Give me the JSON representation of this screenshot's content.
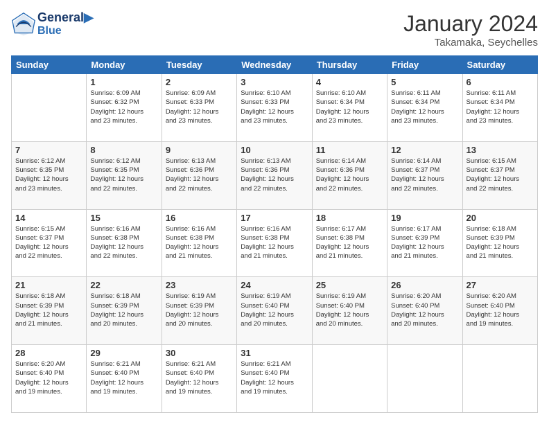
{
  "header": {
    "logo_line1": "General",
    "logo_line2": "Blue",
    "month_title": "January 2024",
    "subtitle": "Takamaka, Seychelles"
  },
  "days_of_week": [
    "Sunday",
    "Monday",
    "Tuesday",
    "Wednesday",
    "Thursday",
    "Friday",
    "Saturday"
  ],
  "weeks": [
    [
      {
        "day": "",
        "info": ""
      },
      {
        "day": "1",
        "info": "Sunrise: 6:09 AM\nSunset: 6:32 PM\nDaylight: 12 hours\nand 23 minutes."
      },
      {
        "day": "2",
        "info": "Sunrise: 6:09 AM\nSunset: 6:33 PM\nDaylight: 12 hours\nand 23 minutes."
      },
      {
        "day": "3",
        "info": "Sunrise: 6:10 AM\nSunset: 6:33 PM\nDaylight: 12 hours\nand 23 minutes."
      },
      {
        "day": "4",
        "info": "Sunrise: 6:10 AM\nSunset: 6:34 PM\nDaylight: 12 hours\nand 23 minutes."
      },
      {
        "day": "5",
        "info": "Sunrise: 6:11 AM\nSunset: 6:34 PM\nDaylight: 12 hours\nand 23 minutes."
      },
      {
        "day": "6",
        "info": "Sunrise: 6:11 AM\nSunset: 6:34 PM\nDaylight: 12 hours\nand 23 minutes."
      }
    ],
    [
      {
        "day": "7",
        "info": ""
      },
      {
        "day": "8",
        "info": "Sunrise: 6:12 AM\nSunset: 6:35 PM\nDaylight: 12 hours\nand 22 minutes."
      },
      {
        "day": "9",
        "info": "Sunrise: 6:13 AM\nSunset: 6:36 PM\nDaylight: 12 hours\nand 22 minutes."
      },
      {
        "day": "10",
        "info": "Sunrise: 6:13 AM\nSunset: 6:36 PM\nDaylight: 12 hours\nand 22 minutes."
      },
      {
        "day": "11",
        "info": "Sunrise: 6:14 AM\nSunset: 6:36 PM\nDaylight: 12 hours\nand 22 minutes."
      },
      {
        "day": "12",
        "info": "Sunrise: 6:14 AM\nSunset: 6:37 PM\nDaylight: 12 hours\nand 22 minutes."
      },
      {
        "day": "13",
        "info": "Sunrise: 6:15 AM\nSunset: 6:37 PM\nDaylight: 12 hours\nand 22 minutes."
      }
    ],
    [
      {
        "day": "14",
        "info": ""
      },
      {
        "day": "15",
        "info": "Sunrise: 6:16 AM\nSunset: 6:38 PM\nDaylight: 12 hours\nand 22 minutes."
      },
      {
        "day": "16",
        "info": "Sunrise: 6:16 AM\nSunset: 6:38 PM\nDaylight: 12 hours\nand 21 minutes."
      },
      {
        "day": "17",
        "info": "Sunrise: 6:16 AM\nSunset: 6:38 PM\nDaylight: 12 hours\nand 21 minutes."
      },
      {
        "day": "18",
        "info": "Sunrise: 6:17 AM\nSunset: 6:38 PM\nDaylight: 12 hours\nand 21 minutes."
      },
      {
        "day": "19",
        "info": "Sunrise: 6:17 AM\nSunset: 6:39 PM\nDaylight: 12 hours\nand 21 minutes."
      },
      {
        "day": "20",
        "info": "Sunrise: 6:18 AM\nSunset: 6:39 PM\nDaylight: 12 hours\nand 21 minutes."
      }
    ],
    [
      {
        "day": "21",
        "info": ""
      },
      {
        "day": "22",
        "info": "Sunrise: 6:18 AM\nSunset: 6:39 PM\nDaylight: 12 hours\nand 20 minutes."
      },
      {
        "day": "23",
        "info": "Sunrise: 6:19 AM\nSunset: 6:39 PM\nDaylight: 12 hours\nand 20 minutes."
      },
      {
        "day": "24",
        "info": "Sunrise: 6:19 AM\nSunset: 6:40 PM\nDaylight: 12 hours\nand 20 minutes."
      },
      {
        "day": "25",
        "info": "Sunrise: 6:19 AM\nSunset: 6:40 PM\nDaylight: 12 hours\nand 20 minutes."
      },
      {
        "day": "26",
        "info": "Sunrise: 6:20 AM\nSunset: 6:40 PM\nDaylight: 12 hours\nand 20 minutes."
      },
      {
        "day": "27",
        "info": "Sunrise: 6:20 AM\nSunset: 6:40 PM\nDaylight: 12 hours\nand 19 minutes."
      }
    ],
    [
      {
        "day": "28",
        "info": "Sunrise: 6:20 AM\nSunset: 6:40 PM\nDaylight: 12 hours\nand 19 minutes."
      },
      {
        "day": "29",
        "info": "Sunrise: 6:21 AM\nSunset: 6:40 PM\nDaylight: 12 hours\nand 19 minutes."
      },
      {
        "day": "30",
        "info": "Sunrise: 6:21 AM\nSunset: 6:40 PM\nDaylight: 12 hours\nand 19 minutes."
      },
      {
        "day": "31",
        "info": "Sunrise: 6:21 AM\nSunset: 6:40 PM\nDaylight: 12 hours\nand 19 minutes."
      },
      {
        "day": "",
        "info": ""
      },
      {
        "day": "",
        "info": ""
      },
      {
        "day": "",
        "info": ""
      }
    ]
  ],
  "week7_sunday": {
    "info": "Sunrise: 6:12 AM\nSunset: 6:35 PM\nDaylight: 12 hours\nand 23 minutes."
  },
  "week14_sunday": {
    "info": "Sunrise: 6:15 AM\nSunset: 6:37 PM\nDaylight: 12 hours\nand 22 minutes."
  },
  "week21_sunday": {
    "info": "Sunrise: 6:18 AM\nSunset: 6:39 PM\nDaylight: 12 hours\nand 21 minutes."
  }
}
